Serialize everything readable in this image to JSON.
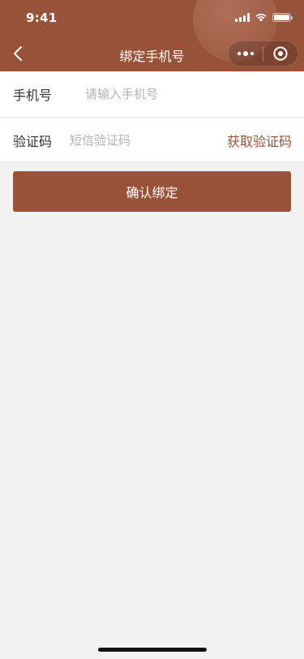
{
  "status_bar": {
    "time": "9:41"
  },
  "nav": {
    "title": "绑定手机号"
  },
  "form": {
    "phone": {
      "label": "手机号",
      "placeholder": "请输入手机号"
    },
    "code": {
      "label": "验证码",
      "placeholder": "短信验证码",
      "get_code_label": "获取验证码"
    }
  },
  "confirm_label": "确认绑定",
  "colors": {
    "primary": "#99523a",
    "background": "#f2f2f2",
    "placeholder": "#b3b3b3",
    "text": "#333333"
  },
  "icons": {
    "back": "chevron-left-icon",
    "more": "more-dots-icon",
    "close": "target-circle-icon",
    "signal": "signal-icon",
    "wifi": "wifi-icon",
    "battery": "battery-icon"
  }
}
